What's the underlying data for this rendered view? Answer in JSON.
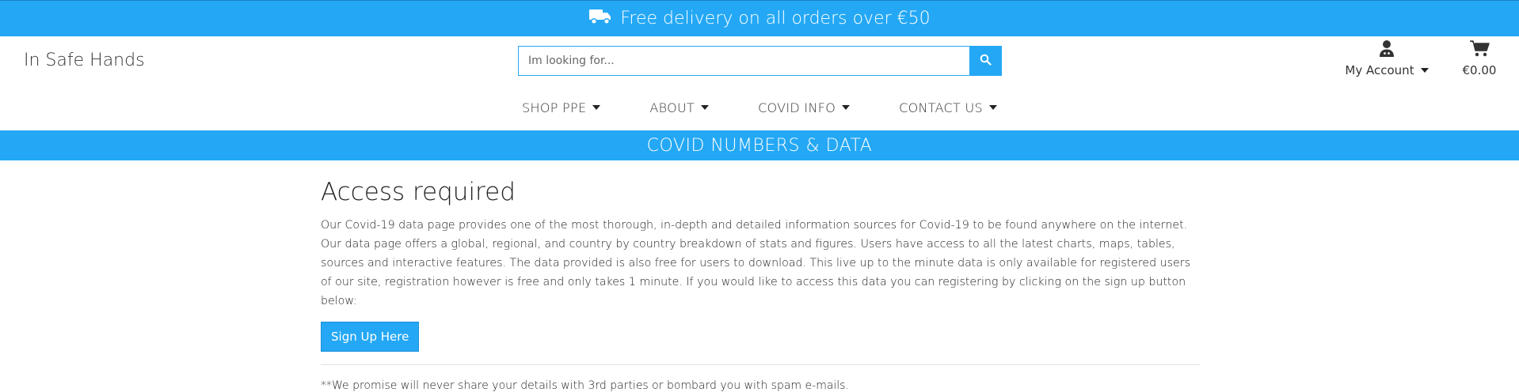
{
  "promo_bar": {
    "text": "Free delivery on all orders over €50",
    "icon": "truck-icon"
  },
  "brand": {
    "name": "In Safe Hands"
  },
  "search": {
    "placeholder": "Im looking for...",
    "button_icon": "search-icon"
  },
  "account": {
    "label": "My Account",
    "icon": "user-icon"
  },
  "cart": {
    "amount": "€0.00",
    "icon": "cart-icon"
  },
  "nav": {
    "items": [
      {
        "label": "SHOP PPE"
      },
      {
        "label": "ABOUT"
      },
      {
        "label": "COVID INFO"
      },
      {
        "label": "CONTACT US"
      }
    ]
  },
  "section_bar": {
    "title": "COVID NUMBERS & DATA"
  },
  "main": {
    "heading": "Access required",
    "body": "Our Covid-19 data page provides one of the most thorough, in-depth and detailed information sources for Covid-19 to be found anywhere on the internet. Our data page offers a global, regional, and country by country breakdown of stats and figures. Users have access to all the latest charts, maps, tables, sources and interactive features. The data provided is also free for users to download. This live up to the minute data is only available for registered users of our site, registration however is free and only takes 1 minute. If you would like to access this data you can registering by clicking on the sign up button below:",
    "signup_label": "Sign Up Here",
    "footnote": "**We promise will never share your details with 3rd parties or bombard you with spam e-mails."
  },
  "colors": {
    "accent": "#24a8f5",
    "text": "#222222"
  }
}
